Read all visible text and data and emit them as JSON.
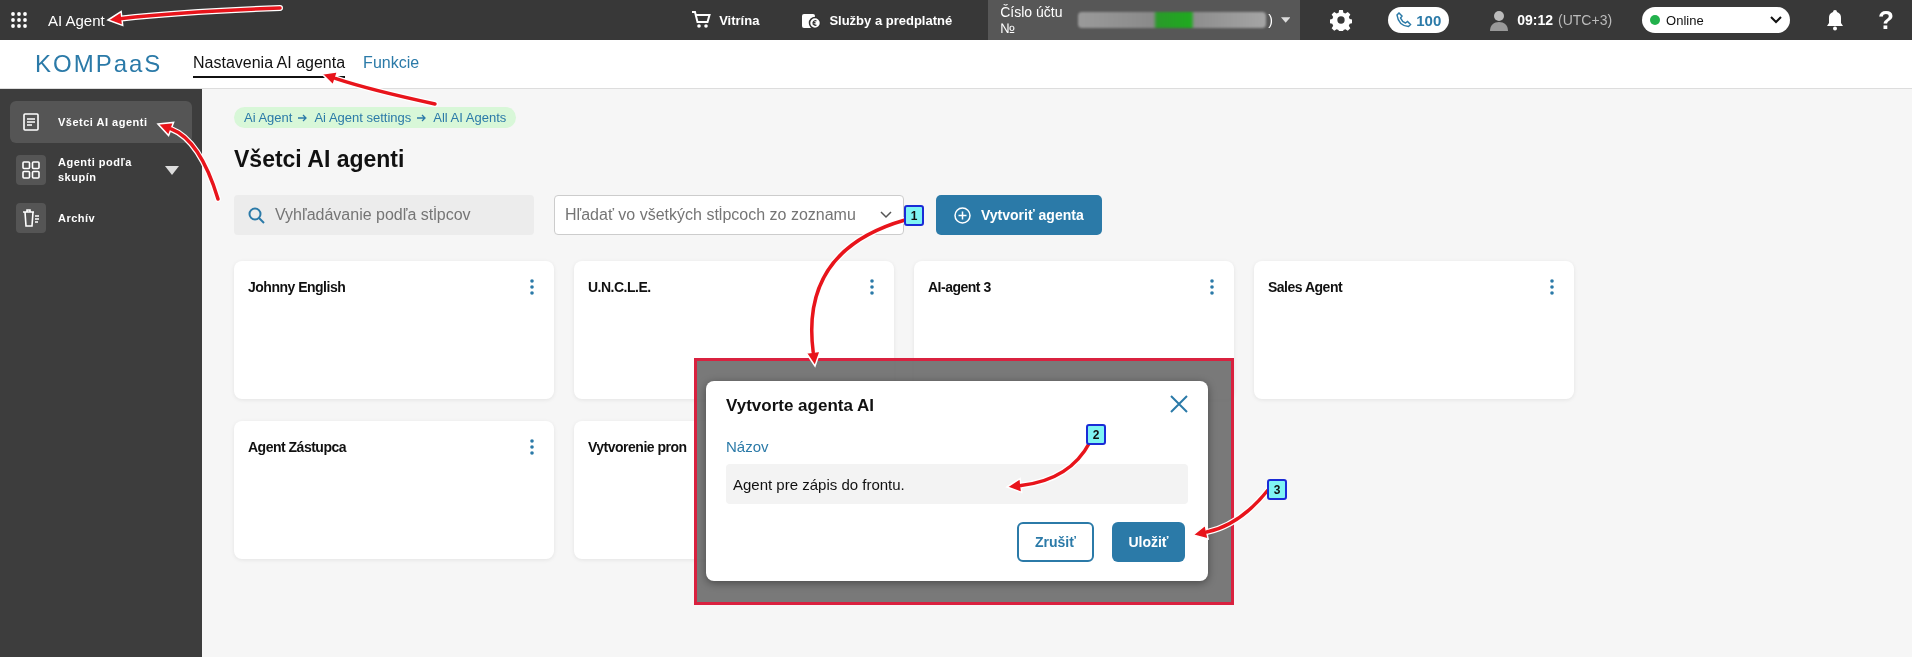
{
  "topbar": {
    "app_title": "AI Agent",
    "links": [
      {
        "label": "Vitrína"
      },
      {
        "label": "Služby a predplatné"
      }
    ],
    "help": "?",
    "account_label": "Číslo účtu №",
    "account_suffix": ")",
    "calls": "100",
    "time": "09:12",
    "timezone": "(UTC+3)",
    "status": {
      "value": "Online",
      "color": "#22b14c"
    }
  },
  "logo": "KOMPaaS",
  "tabs": [
    {
      "label": "Nastavenia AI agenta",
      "selected": true
    },
    {
      "label": "Funkcie",
      "selected": false
    }
  ],
  "sidebar": {
    "items": [
      {
        "label": "Všetci AI agenti",
        "selected": true,
        "expandable": false
      },
      {
        "label": "Agenti podľa skupín",
        "selected": false,
        "expandable": true
      },
      {
        "label": "Archív",
        "selected": false,
        "expandable": false
      }
    ]
  },
  "breadcrumb": [
    "Ai Agent",
    "Ai Agent settings",
    "All AI Agents"
  ],
  "page_title": "Všetci AI agenti",
  "column_search": {
    "placeholder": "Vyhľadávanie podľa stĺpcov"
  },
  "list_search": {
    "placeholder": "Hľadať vo všetkých stĺpcoch zo zoznamu"
  },
  "create_button": "Vytvoriť agenta",
  "cards": [
    {
      "title": "Johnny English"
    },
    {
      "title": "U.N.C.L.E."
    },
    {
      "title": "AI-agent 3"
    },
    {
      "title": "Sales Agent"
    },
    {
      "title": "Agent Zástupca"
    },
    {
      "title": "Vytvorenie pron"
    }
  ],
  "dialog": {
    "title": "Vytvorte agenta AI",
    "field_label": "Názov",
    "field_value": "Agent pre zápis do frontu.",
    "cancel": "Zrušiť",
    "save": "Uložiť"
  },
  "annotations": {
    "badges": [
      "1",
      "2",
      "3"
    ]
  }
}
